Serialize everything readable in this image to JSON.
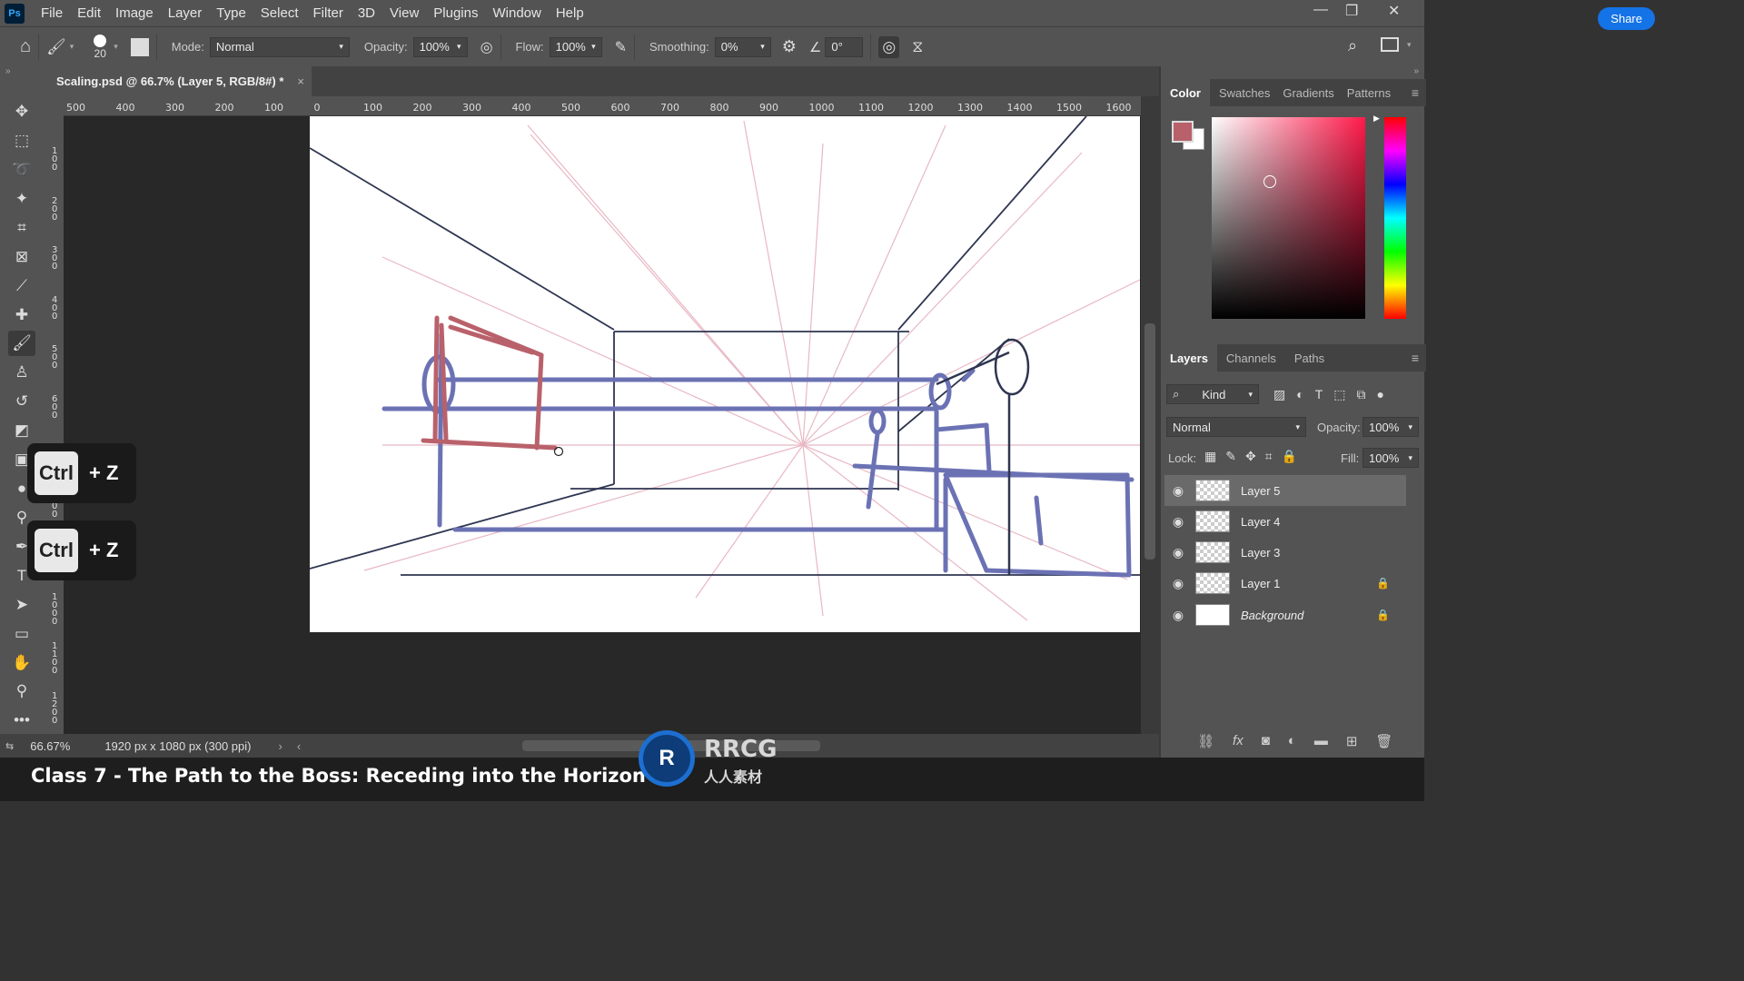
{
  "app": {
    "logo": "Ps"
  },
  "menu": [
    "File",
    "Edit",
    "Image",
    "Layer",
    "Type",
    "Select",
    "Filter",
    "3D",
    "View",
    "Plugins",
    "Window",
    "Help"
  ],
  "options": {
    "brush_size": "20",
    "mode_label": "Mode:",
    "mode_value": "Normal",
    "opacity_label": "Opacity:",
    "opacity_value": "100%",
    "flow_label": "Flow:",
    "flow_value": "100%",
    "smoothing_label": "Smoothing:",
    "smoothing_value": "0%",
    "angle_value": "0°",
    "share_label": "Share"
  },
  "document": {
    "tab_title": "Scaling.psd @ 66.7% (Layer 5, RGB/8#) *",
    "close": "×"
  },
  "ruler": {
    "h_ticks": [
      "500",
      "400",
      "300",
      "200",
      "100",
      "0",
      "100",
      "200",
      "300",
      "400",
      "500",
      "600",
      "700",
      "800",
      "900",
      "1000",
      "1100",
      "1200",
      "1300",
      "1400",
      "1500",
      "1600"
    ],
    "v_ticks": [
      "1 0 0",
      "2 0 0",
      "3 0 0",
      "4 0 0",
      "5 0 0",
      "6 0 0",
      "7 0 0",
      "8 0 0",
      "9 0 0",
      "1 0 0 0",
      "1 1 0 0",
      "1 2 0 0"
    ]
  },
  "status": {
    "zoom": "66.67%",
    "doc_info": "1920 px x 1080 px (300 ppi)"
  },
  "shortcuts": [
    {
      "key": "Ctrl",
      "rest": "+ Z"
    },
    {
      "key": "Ctrl",
      "rest": "+ Z"
    }
  ],
  "color_panel": {
    "tabs": [
      "Color",
      "Swatches",
      "Gradients",
      "Patterns"
    ],
    "foreground": "#b9616b",
    "background": "#ffffff"
  },
  "layers_panel": {
    "tabs": [
      "Layers",
      "Channels",
      "Paths"
    ],
    "filter_label": "Kind",
    "blend_mode": "Normal",
    "opacity_label": "Opacity:",
    "opacity_value": "100%",
    "lock_label": "Lock:",
    "fill_label": "Fill:",
    "fill_value": "100%",
    "layers": [
      {
        "name": "Layer 5",
        "selected": true,
        "locked": false
      },
      {
        "name": "Layer 4",
        "selected": false,
        "locked": false
      },
      {
        "name": "Layer 3",
        "selected": false,
        "locked": false
      },
      {
        "name": "Layer 1",
        "selected": false,
        "locked": true
      },
      {
        "name": "Background",
        "selected": false,
        "locked": true
      }
    ]
  },
  "caption": "Class 7 - The Path to the Boss: Receding into the Horizon",
  "watermark": {
    "text_top": "RRCG",
    "text_bottom": "人人素材"
  },
  "colors": {
    "sketch_blue": "#6b72b4",
    "sketch_red": "#b9616b",
    "guide_pink": "#e8b8c4",
    "dark_line": "#2e3550"
  }
}
